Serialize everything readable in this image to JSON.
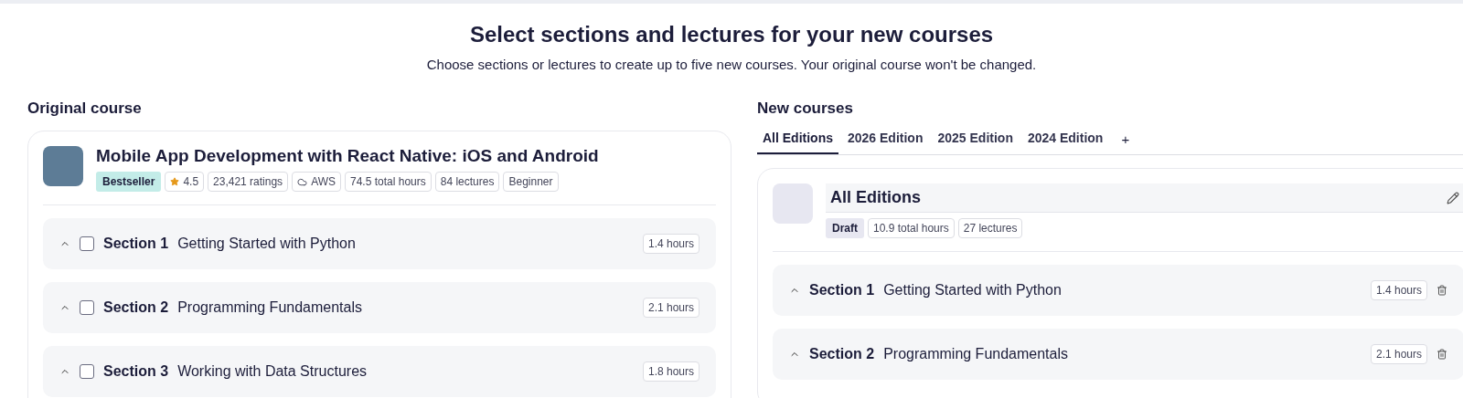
{
  "header": {
    "title": "Select sections and lectures for your new courses",
    "subtitle": "Choose sections or lectures to create up to five new courses. Your original course won't be changed."
  },
  "original": {
    "heading": "Original course",
    "course": {
      "title": "Mobile App Development with React Native: iOS and Android",
      "badge": "Bestseller",
      "rating": "4.5",
      "ratings": "23,421 ratings",
      "provider": "AWS",
      "hours": "74.5 total hours",
      "lectures": "84 lectures",
      "level": "Beginner"
    },
    "sections": [
      {
        "label": "Section 1",
        "title": "Getting Started with Python",
        "duration": "1.4 hours",
        "checked": false,
        "expanded": true
      },
      {
        "label": "Section 2",
        "title": "Programming Fundamentals",
        "duration": "2.1 hours",
        "checked": false,
        "expanded": true
      },
      {
        "label": "Section 3",
        "title": "Working with Data Structures",
        "duration": "1.8 hours",
        "checked": false,
        "expanded": true
      }
    ]
  },
  "new_courses": {
    "heading": "New courses",
    "tabs": [
      {
        "label": "All Editions",
        "selected": true
      },
      {
        "label": "2026 Edition",
        "selected": false
      },
      {
        "label": "2025 Edition",
        "selected": false
      },
      {
        "label": "2024 Edition",
        "selected": false
      }
    ],
    "add_tab": "+",
    "draft": {
      "title": "All Editions",
      "status": "Draft",
      "hours": "10.9 total hours",
      "lectures": "27 lectures"
    },
    "sections": [
      {
        "label": "Section 1",
        "title": "Getting Started with Python",
        "duration": "1.4 hours",
        "expanded": true
      },
      {
        "label": "Section 2",
        "title": "Programming Fundamentals",
        "duration": "2.1 hours",
        "expanded": true
      }
    ]
  }
}
